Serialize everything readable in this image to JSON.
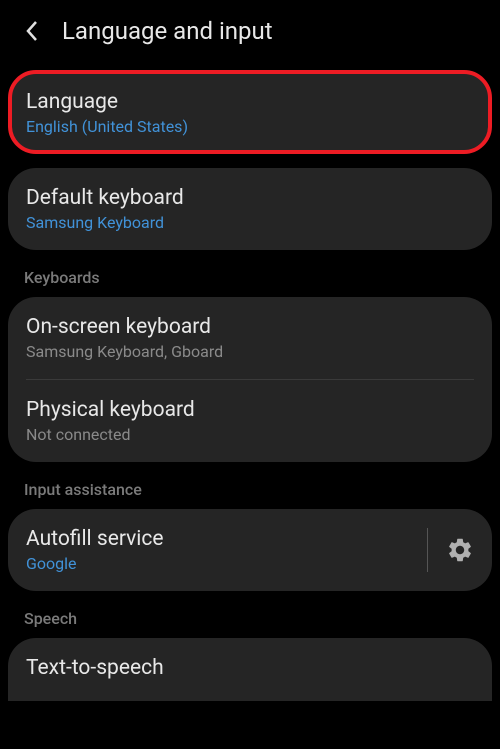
{
  "header": {
    "title": "Language and input"
  },
  "sections": {
    "main": {
      "language": {
        "title": "Language",
        "subtitle": "English (United States)"
      },
      "default_keyboard": {
        "title": "Default keyboard",
        "subtitle": "Samsung Keyboard"
      }
    },
    "keyboards": {
      "label": "Keyboards",
      "onscreen": {
        "title": "On-screen keyboard",
        "subtitle": "Samsung Keyboard, Gboard"
      },
      "physical": {
        "title": "Physical keyboard",
        "subtitle": "Not connected"
      }
    },
    "input_assistance": {
      "label": "Input assistance",
      "autofill": {
        "title": "Autofill service",
        "subtitle": "Google"
      }
    },
    "speech": {
      "label": "Speech",
      "tts": {
        "title": "Text-to-speech"
      }
    }
  }
}
